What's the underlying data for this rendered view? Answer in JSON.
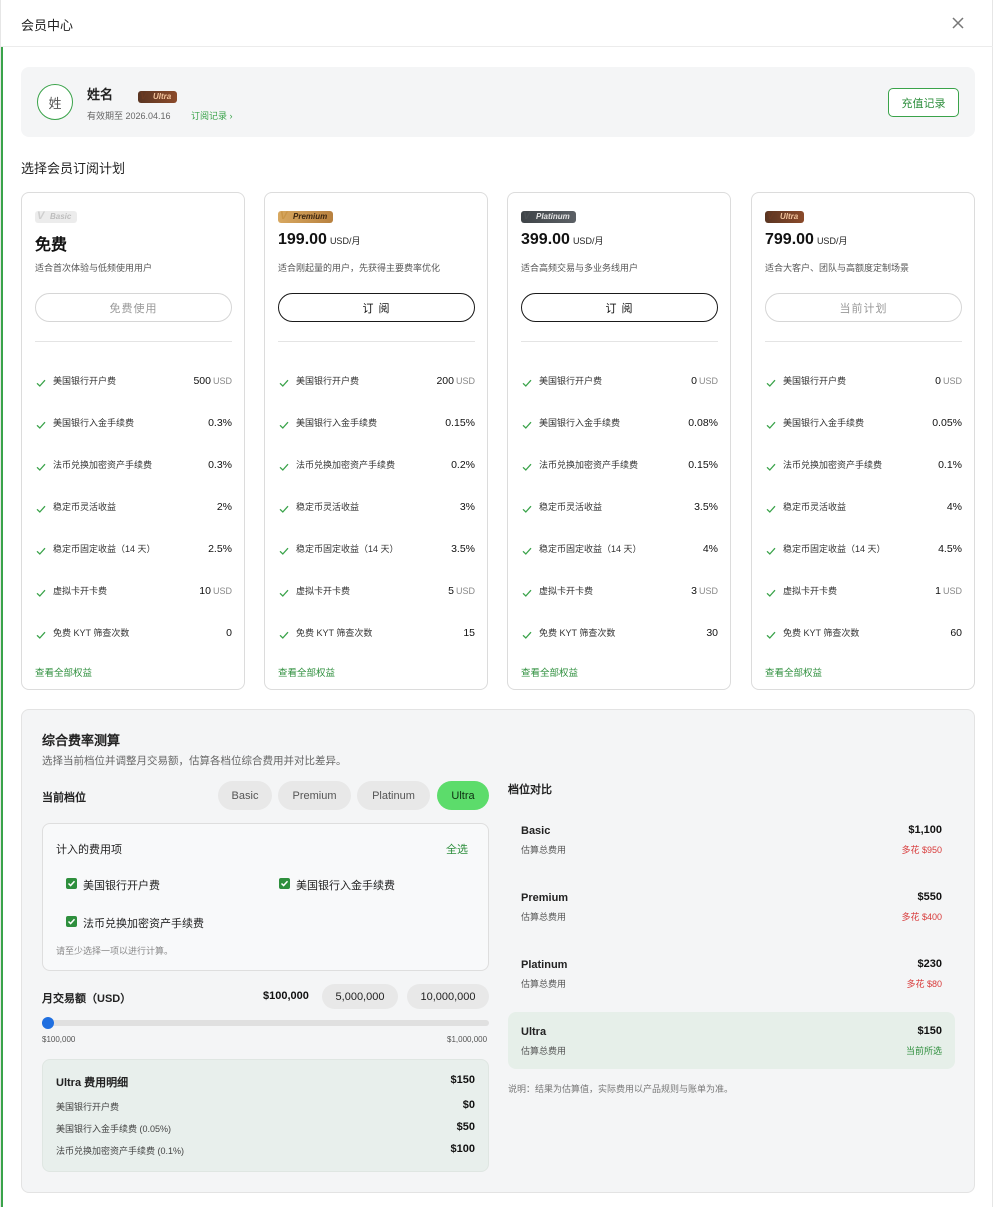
{
  "header": {
    "title": "会员中心"
  },
  "profile": {
    "avatar_text": "姓",
    "name": "姓名",
    "badge": "Ultra",
    "validity": "有效期至 2026.04.16",
    "records_link": "订阅记录 ›",
    "recharge_label": "充值记录"
  },
  "plans_title": "选择会员订阅计划",
  "plans": [
    {
      "badge": "Basic",
      "price": "免费",
      "unit": "",
      "desc": "适合首次体验与低频使用用户",
      "button": "免费使用",
      "features": [
        {
          "name": "美国银行开户费",
          "value": "500",
          "unit": "USD"
        },
        {
          "name": "美国银行入金手续费",
          "value": "0.3%",
          "unit": ""
        },
        {
          "name": "法币兑换加密资产手续费",
          "value": "0.3%",
          "unit": ""
        },
        {
          "name": "稳定币灵活收益",
          "value": "2%",
          "unit": ""
        },
        {
          "name": "稳定币固定收益（14 天）",
          "value": "2.5%",
          "unit": ""
        },
        {
          "name": "虚拟卡开卡费",
          "value": "10",
          "unit": "USD"
        },
        {
          "name": "免费 KYT 筛查次数",
          "value": "0",
          "unit": ""
        }
      ],
      "view_all": "查看全部权益"
    },
    {
      "badge": "Premium",
      "price": "199.00",
      "unit": "USD/月",
      "desc": "适合刚起量的用户，先获得主要费率优化",
      "button": "订 阅",
      "features": [
        {
          "name": "美国银行开户费",
          "value": "200",
          "unit": "USD"
        },
        {
          "name": "美国银行入金手续费",
          "value": "0.15%",
          "unit": ""
        },
        {
          "name": "法币兑换加密资产手续费",
          "value": "0.2%",
          "unit": ""
        },
        {
          "name": "稳定币灵活收益",
          "value": "3%",
          "unit": ""
        },
        {
          "name": "稳定币固定收益（14 天）",
          "value": "3.5%",
          "unit": ""
        },
        {
          "name": "虚拟卡开卡费",
          "value": "5",
          "unit": "USD"
        },
        {
          "name": "免费 KYT 筛查次数",
          "value": "15",
          "unit": ""
        }
      ],
      "view_all": "查看全部权益"
    },
    {
      "badge": "Platinum",
      "price": "399.00",
      "unit": "USD/月",
      "desc": "适合高频交易与多业务线用户",
      "button": "订 阅",
      "features": [
        {
          "name": "美国银行开户费",
          "value": "0",
          "unit": "USD"
        },
        {
          "name": "美国银行入金手续费",
          "value": "0.08%",
          "unit": ""
        },
        {
          "name": "法币兑换加密资产手续费",
          "value": "0.15%",
          "unit": ""
        },
        {
          "name": "稳定币灵活收益",
          "value": "3.5%",
          "unit": ""
        },
        {
          "name": "稳定币固定收益（14 天）",
          "value": "4%",
          "unit": ""
        },
        {
          "name": "虚拟卡开卡费",
          "value": "3",
          "unit": "USD"
        },
        {
          "name": "免费 KYT 筛查次数",
          "value": "30",
          "unit": ""
        }
      ],
      "view_all": "查看全部权益"
    },
    {
      "badge": "Ultra",
      "price": "799.00",
      "unit": "USD/月",
      "desc": "适合大客户、团队与高额度定制场景",
      "button": "当前计划",
      "features": [
        {
          "name": "美国银行开户费",
          "value": "0",
          "unit": "USD"
        },
        {
          "name": "美国银行入金手续费",
          "value": "0.05%",
          "unit": ""
        },
        {
          "name": "法币兑换加密资产手续费",
          "value": "0.1%",
          "unit": ""
        },
        {
          "name": "稳定币灵活收益",
          "value": "4%",
          "unit": ""
        },
        {
          "name": "稳定币固定收益（14 天）",
          "value": "4.5%",
          "unit": ""
        },
        {
          "name": "虚拟卡开卡费",
          "value": "1",
          "unit": "USD"
        },
        {
          "name": "免费 KYT 筛查次数",
          "value": "60",
          "unit": ""
        }
      ],
      "view_all": "查看全部权益"
    }
  ],
  "calc": {
    "title": "综合费率测算",
    "subtitle": "选择当前档位并调整月交易额，估算各档位综合费用并对比差异。",
    "tier_label": "当前档位",
    "tiers": [
      "Basic",
      "Premium",
      "Platinum",
      "Ultra"
    ],
    "selected_tier": "Ultra",
    "fee_box_title": "计入的费用项",
    "select_all": "全选",
    "fee_options": [
      "美国银行开户费",
      "美国银行入金手续费",
      "法币兑换加密资产手续费"
    ],
    "fee_hint": "请至少选择一项以进行计算。",
    "volume_label": "月交易额（USD）",
    "volume_current": "$100,000",
    "volume_presets": [
      "5,000,000",
      "10,000,000"
    ],
    "slider_min": "$100,000",
    "slider_max": "$1,000,000",
    "slider_fraction": 0.0,
    "detail": {
      "title": "Ultra 费用明细",
      "total": "$150",
      "rows": [
        {
          "name": "美国银行开户费",
          "value": "$0"
        },
        {
          "name": "美国银行入金手续费 (0.05%)",
          "value": "$50"
        },
        {
          "name": "法币兑换加密资产手续费 (0.1%)",
          "value": "$100"
        }
      ]
    },
    "compare_title": "档位对比",
    "compare": [
      {
        "name": "Basic",
        "sub": "估算总费用",
        "value": "$1,100",
        "diff": "多花 $950"
      },
      {
        "name": "Premium",
        "sub": "估算总费用",
        "value": "$550",
        "diff": "多花 $400"
      },
      {
        "name": "Platinum",
        "sub": "估算总费用",
        "value": "$230",
        "diff": "多花 $80"
      },
      {
        "name": "Ultra",
        "sub": "估算总费用",
        "value": "$150",
        "diff": "当前所选"
      }
    ],
    "note": "说明：结果为估算值，实际费用以产品规则与账单为准。"
  }
}
